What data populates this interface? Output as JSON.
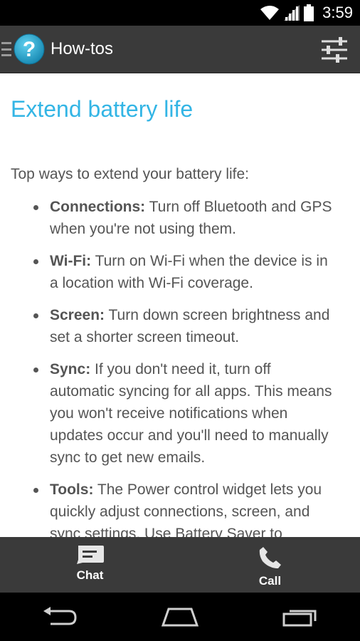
{
  "status_bar": {
    "time": "3:59",
    "icons": [
      "wifi-icon",
      "signal-icon",
      "battery-icon"
    ]
  },
  "action_bar": {
    "title": "How-tos",
    "app_icon": "help-question-icon",
    "settings_icon": "sliders-icon"
  },
  "article": {
    "title": "Extend battery life",
    "intro": "Top ways to extend your battery life:",
    "tips": [
      {
        "heading": "Connections:",
        "text": " Turn off Bluetooth and GPS when you're not using them."
      },
      {
        "heading": "Wi-Fi:",
        "text": " Turn on Wi-Fi when the device is in a location with Wi-Fi coverage."
      },
      {
        "heading": "Screen:",
        "text": " Turn down screen brightness and set a shorter screen timeout."
      },
      {
        "heading": "Sync:",
        "text": " If you don't need it, turn off automatic syncing for all apps. This means you won't receive notifications when updates occur and you'll need to manually sync to get new emails."
      },
      {
        "heading": "Tools:",
        "text": " The Power control widget lets you quickly adjust connections, screen, and sync settings. Use Battery Saver to"
      }
    ]
  },
  "bottom_bar": {
    "chat_label": "Chat",
    "call_label": "Call"
  },
  "nav_bar": {
    "icons": [
      "back-icon",
      "home-icon",
      "recent-apps-icon"
    ]
  },
  "colors": {
    "accent": "#33b5e5",
    "action_bar_bg": "#3a3a3a",
    "body_text": "#555555"
  }
}
